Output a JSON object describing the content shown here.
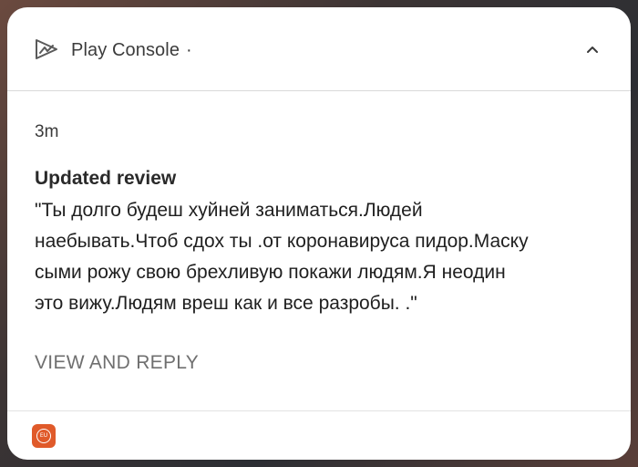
{
  "notification": {
    "app_name": "Play Console",
    "app_name_suffix": "·",
    "app_icon": "play-console-icon",
    "collapse_icon": "chevron-up-icon",
    "timestamp": "3m",
    "title": "Updated review",
    "body": "\"Ты долго будеш хуйней заниматься.Людей\nнаебывать.Чтоб сдох ты .от коронавируса пидор.Маску\nсыми рожу свою брехливую покажи людям.Я неодин\nэто вижу.Людям вреш как и все разробы. .\"",
    "action_label": "VIEW AND REPLY",
    "footer_app_icon": "app-badge-icon",
    "footer_app_icon_text": "EU"
  },
  "colors": {
    "card_background": "#ffffff",
    "footer_icon": "#e05a2a",
    "action_text": "#6f6f6f"
  }
}
